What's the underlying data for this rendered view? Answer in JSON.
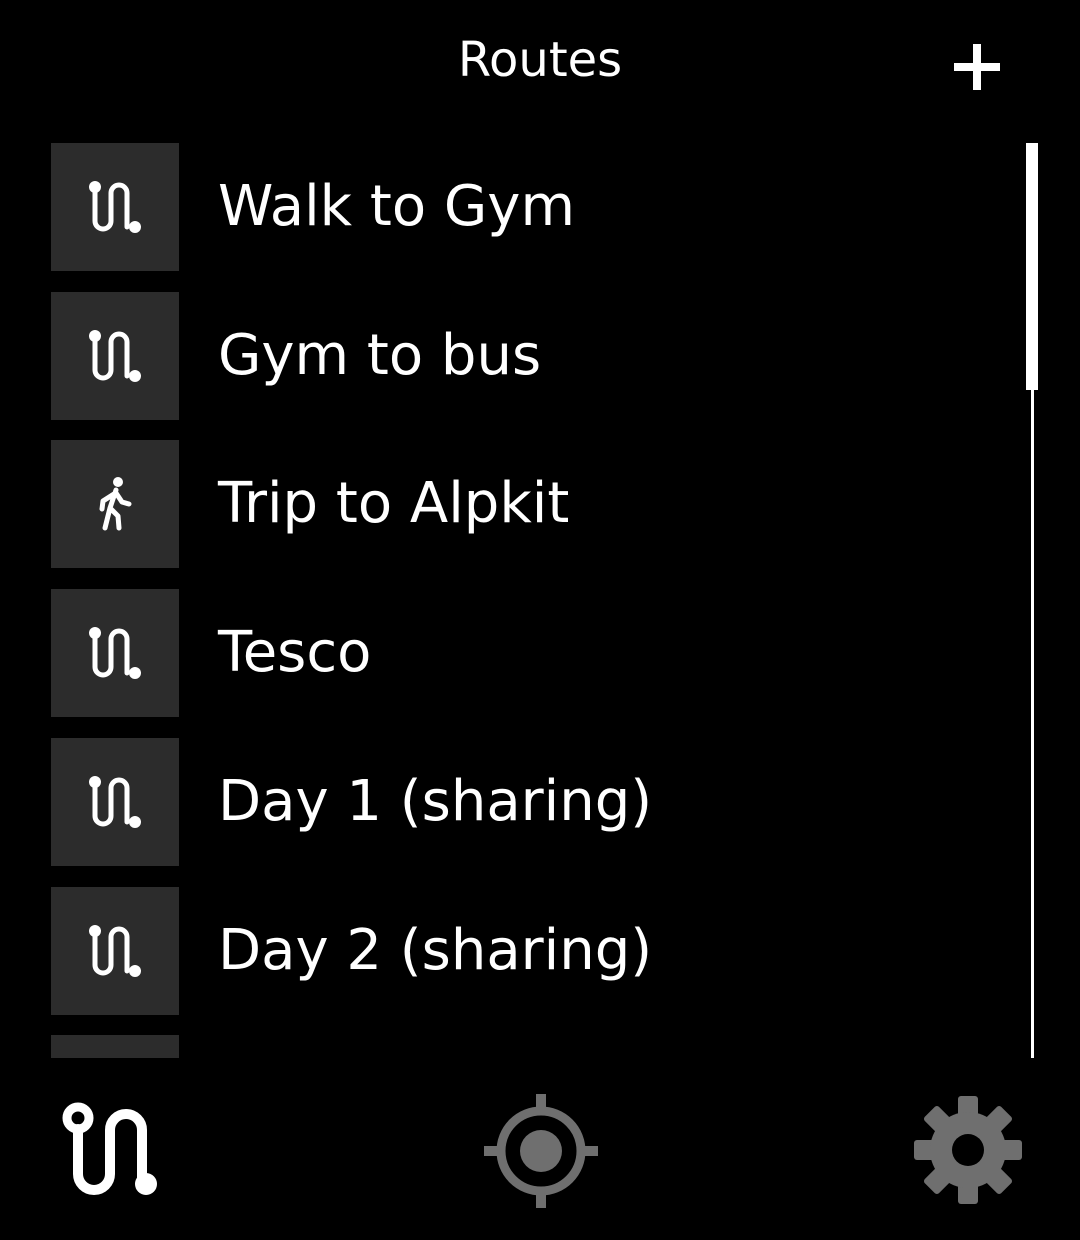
{
  "header": {
    "title": "Routes",
    "add_icon": "plus-icon"
  },
  "routes": [
    {
      "label": "Walk to Gym",
      "icon": "route-icon"
    },
    {
      "label": "Gym to bus",
      "icon": "route-icon"
    },
    {
      "label": "Trip to Alpkit",
      "icon": "walking-person-icon"
    },
    {
      "label": "Tesco",
      "icon": "route-icon"
    },
    {
      "label": "Day 1 (sharing)",
      "icon": "route-icon"
    },
    {
      "label": "Day 2 (sharing)",
      "icon": "route-icon"
    },
    {
      "label": "",
      "icon": "route-icon"
    }
  ],
  "bottom_nav": {
    "routes_icon": "route-icon",
    "locate_icon": "crosshair-icon",
    "settings_icon": "gear-icon",
    "active": "routes"
  },
  "colors": {
    "background": "#000000",
    "tile": "#2c2c2c",
    "text": "#ffffff",
    "inactive_icon": "#6f6f6f"
  }
}
